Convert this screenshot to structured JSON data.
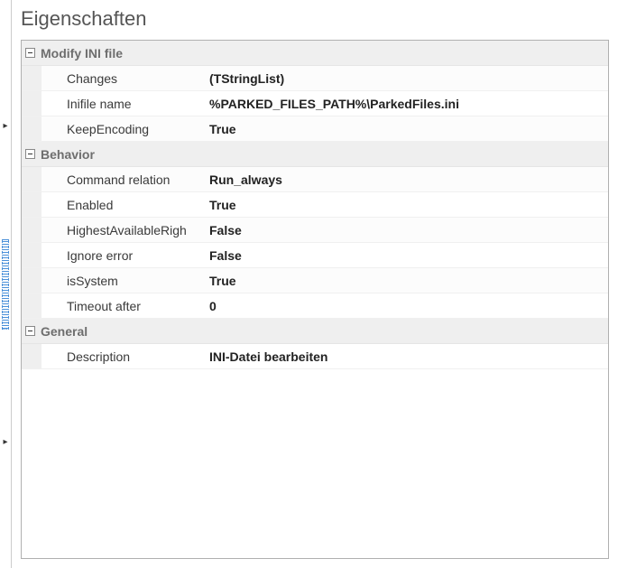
{
  "panel_title": "Eigenschaften",
  "groups": [
    {
      "title": "Modify INI file",
      "rows": [
        {
          "name": "Changes",
          "value": "(TStringList)"
        },
        {
          "name": "Inifile name",
          "value": "%PARKED_FILES_PATH%\\ParkedFiles.ini"
        },
        {
          "name": "KeepEncoding",
          "value": "True"
        }
      ]
    },
    {
      "title": "Behavior",
      "rows": [
        {
          "name": "Command relation",
          "value": "Run_always"
        },
        {
          "name": "Enabled",
          "value": "True"
        },
        {
          "name": "HighestAvailableRigh",
          "value": "False"
        },
        {
          "name": "Ignore error",
          "value": "False"
        },
        {
          "name": "isSystem",
          "value": "True"
        },
        {
          "name": "Timeout after",
          "value": "0"
        }
      ]
    },
    {
      "title": "General",
      "rows": [
        {
          "name": "Description",
          "value": "INI-Datei bearbeiten"
        }
      ]
    }
  ]
}
